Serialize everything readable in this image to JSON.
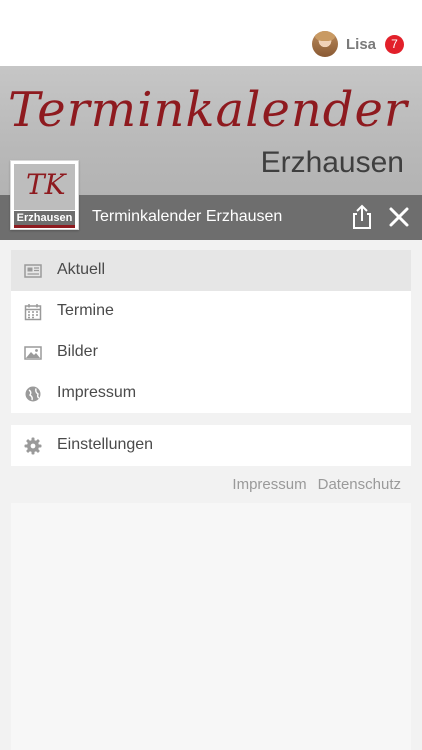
{
  "user": {
    "name": "Lisa",
    "notifications": "7"
  },
  "banner": {
    "script_title": "Terminkalender",
    "place": "Erzhausen"
  },
  "logo": {
    "mark": "TK",
    "label": "Erzhausen"
  },
  "header": {
    "title": "Terminkalender Erzhausen"
  },
  "menu": {
    "items": [
      {
        "label": "Aktuell",
        "icon": "newspaper-icon",
        "active": true
      },
      {
        "label": "Termine",
        "icon": "calendar-icon",
        "active": false
      },
      {
        "label": "Bilder",
        "icon": "image-icon",
        "active": false
      },
      {
        "label": "Impressum",
        "icon": "globe-icon",
        "active": false
      }
    ],
    "settings": {
      "label": "Einstellungen",
      "icon": "gear-icon"
    }
  },
  "footer": {
    "impressum": "Impressum",
    "datenschutz": "Datenschutz"
  },
  "colors": {
    "brand_red": "#8e1a1f",
    "header_gray": "#6e6e6e",
    "badge_red": "#e2202a"
  }
}
